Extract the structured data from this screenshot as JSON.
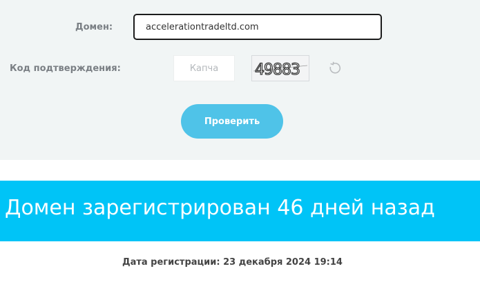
{
  "form": {
    "domain_label": "Домен:",
    "domain_value": "accelerationtradeltd.com",
    "captcha_label": "Код подтверждения:",
    "captcha_placeholder": "Капча",
    "captcha_image_text": "49883",
    "refresh_icon": "refresh-icon",
    "check_button_label": "Проверить"
  },
  "result": {
    "banner_text": "Домен зарегистрирован 46 дней назад",
    "registration_date": "Дата регистрации: 23 декабря 2024 19:14"
  },
  "colors": {
    "panel_background": "#f1f5f5",
    "button": "#4fc3e8",
    "banner": "#00c4f7"
  }
}
